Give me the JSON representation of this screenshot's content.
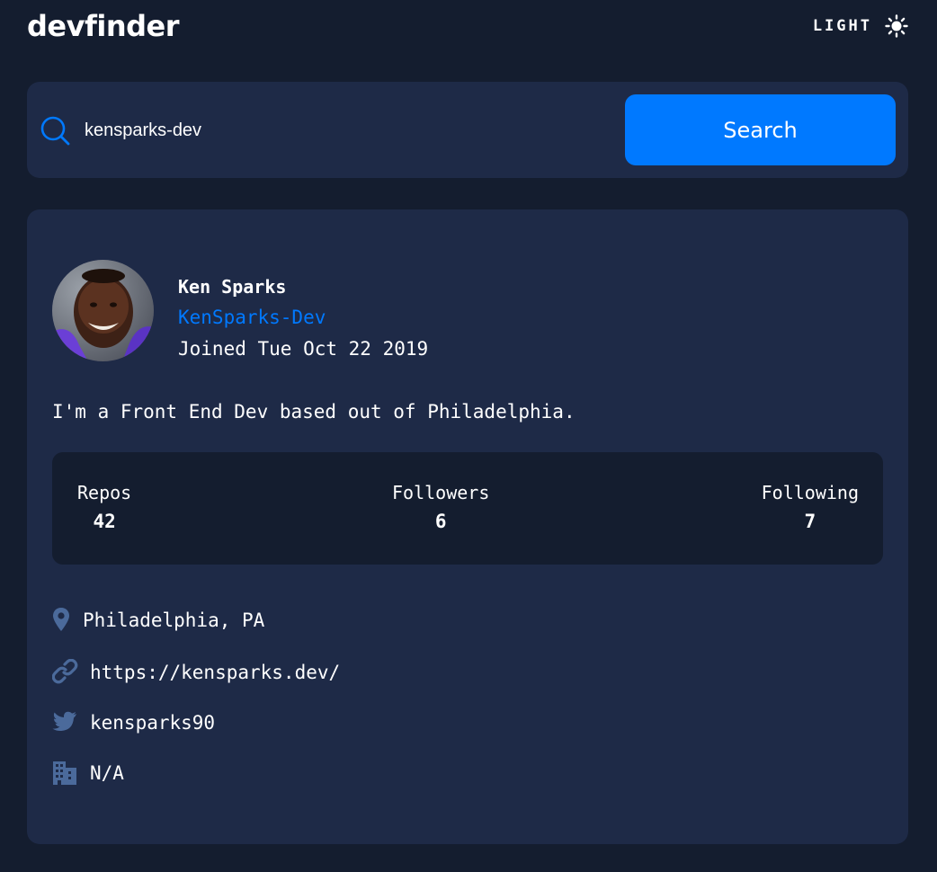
{
  "app": {
    "title": "devfinder",
    "theme_label": "LIGHT",
    "theme_icon": "sun-icon"
  },
  "search": {
    "value": "kensparks-dev",
    "placeholder": "",
    "button_label": "Search"
  },
  "profile": {
    "name": "Ken Sparks",
    "login": "KenSparks-Dev",
    "joined": "Joined Tue Oct 22 2019",
    "bio": "I'm a Front End Dev based out of Philadelphia.",
    "stats": {
      "repos_label": "Repos",
      "repos": "42",
      "followers_label": "Followers",
      "followers": "6",
      "following_label": "Following",
      "following": "7"
    },
    "links": {
      "location": "Philadelphia, PA",
      "blog": "https://kensparks.dev/",
      "twitter": "kensparks90",
      "company": "N/A"
    }
  },
  "colors": {
    "background": "#141d2f",
    "card": "#1e2a47",
    "accent": "#0079ff",
    "icon": "#4b6a9b",
    "text": "#ffffff"
  }
}
